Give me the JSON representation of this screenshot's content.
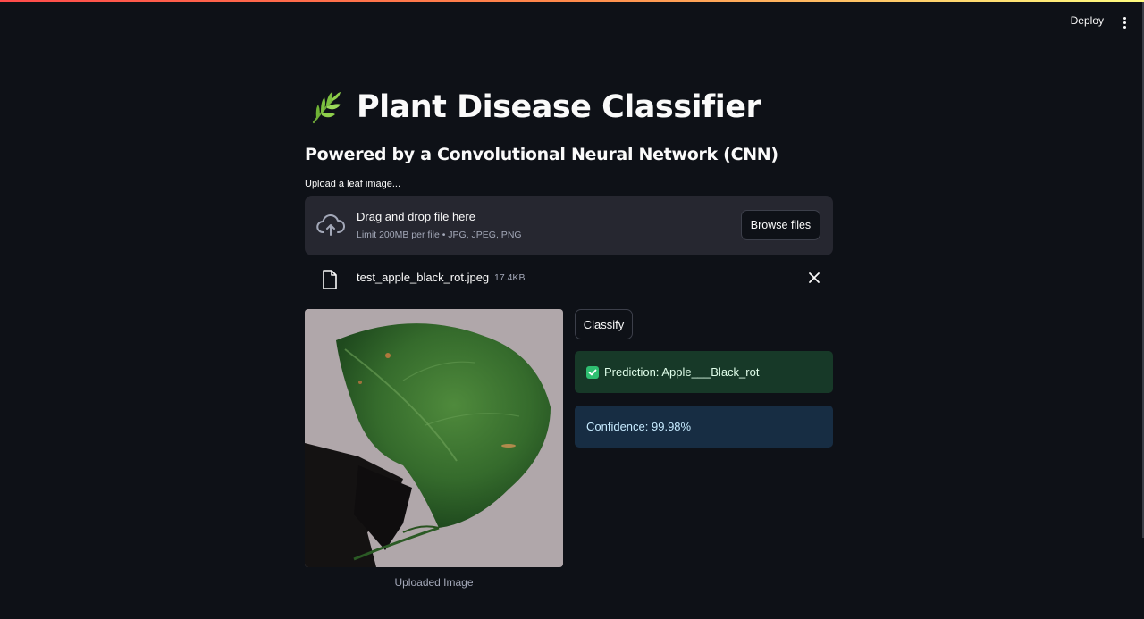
{
  "header": {
    "deploy_label": "Deploy",
    "menu_icon": "more-vertical-icon"
  },
  "main": {
    "title_icon": "seedling-icon",
    "title": "Plant Disease Classifier",
    "subtitle": "Powered by a Convolutional Neural Network (CNN)"
  },
  "uploader": {
    "label": "Upload a leaf image...",
    "dropzone_title": "Drag and drop file here",
    "dropzone_limit": "Limit 200MB per file • JPG, JPEG, PNG",
    "browse_label": "Browse files",
    "file_name": "test_apple_black_rot.jpeg",
    "file_size": "17.4KB"
  },
  "image": {
    "caption": "Uploaded Image"
  },
  "actions": {
    "classify_label": "Classify"
  },
  "results": {
    "prediction": "Prediction: Apple___Black_rot",
    "confidence": "Confidence: 99.98%"
  },
  "colors": {
    "background": "#0e1117",
    "success_bg": "#173928",
    "info_bg": "#172d43",
    "accent_gradient_start": "#ff4b4b",
    "accent_gradient_end": "#fffd80"
  }
}
